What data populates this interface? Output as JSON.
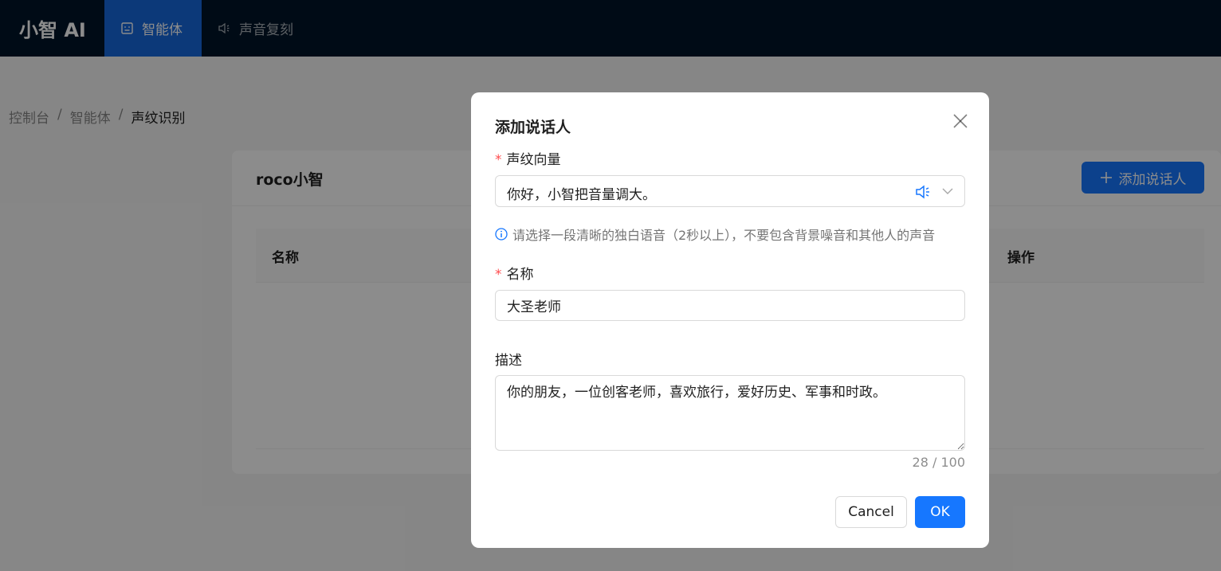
{
  "app": {
    "logo": "小智 AI"
  },
  "nav": [
    {
      "label": "智能体",
      "icon": "robot-icon",
      "active": true
    },
    {
      "label": "声音复刻",
      "icon": "speaker-icon",
      "active": false
    }
  ],
  "breadcrumb": {
    "items": [
      "控制台",
      "智能体",
      "声纹识别"
    ],
    "separator": "/"
  },
  "card": {
    "title": "roco小智",
    "add_button": "添加说话人",
    "table_headers": {
      "name": "名称",
      "actions": "操作"
    }
  },
  "modal": {
    "title": "添加说话人",
    "voiceprint": {
      "label": "声纹向量",
      "required_mark": "*",
      "value": "你好，小智把音量调大。",
      "hint": "请选择一段清晰的独白语音（2秒以上），不要包含背景噪音和其他人的声音"
    },
    "name": {
      "label": "名称",
      "required_mark": "*",
      "value": "大圣老师"
    },
    "description": {
      "label": "描述",
      "value": "你的朋友，一位创客老师，喜欢旅行，爱好历史、军事和时政。",
      "counter": "28 / 100"
    },
    "cancel_label": "Cancel",
    "ok_label": "OK"
  },
  "colors": {
    "primary": "#1677ff",
    "header_bg": "#001529",
    "required": "#ff4d4f"
  }
}
